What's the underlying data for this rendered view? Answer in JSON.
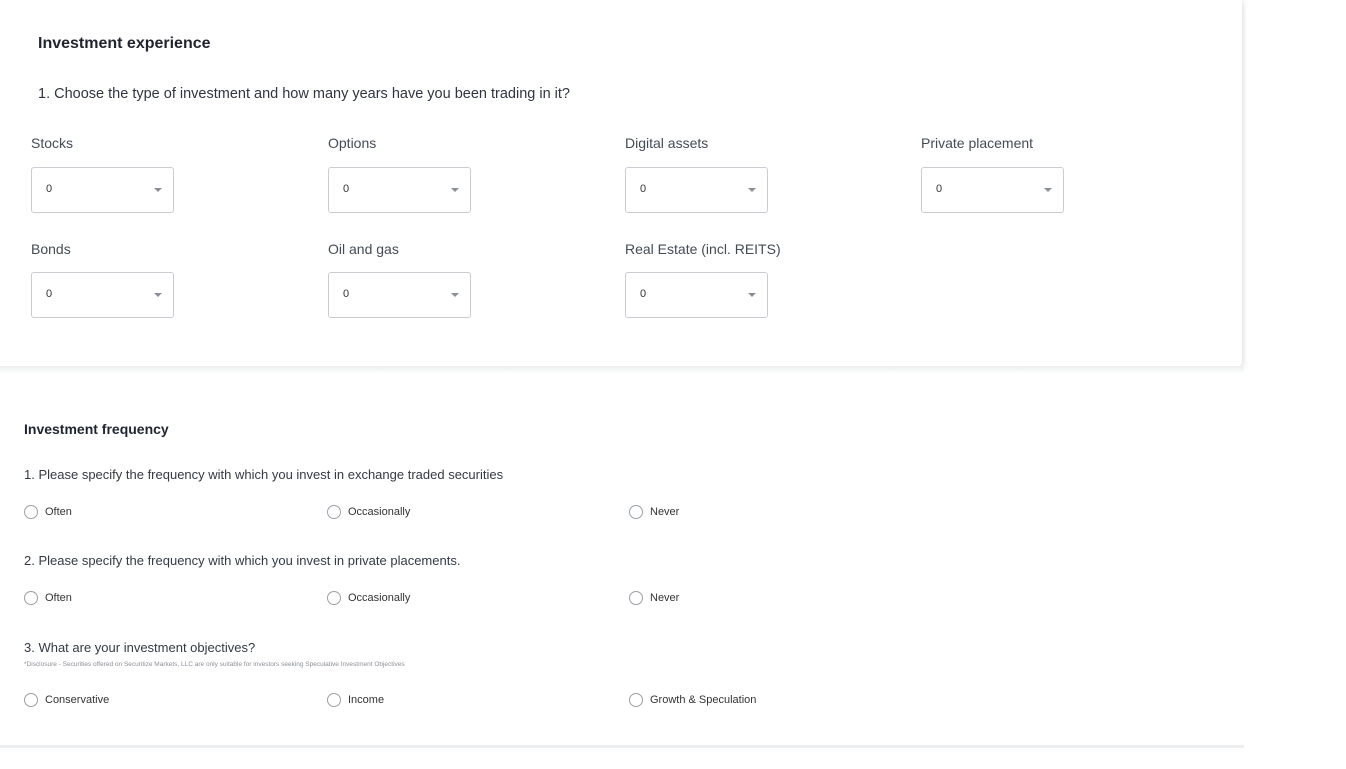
{
  "experience": {
    "title": "Investment experience",
    "question": "1.  Choose the type of investment and how many years have you been trading in it?",
    "fields": [
      {
        "label": "Stocks",
        "value": "0"
      },
      {
        "label": "Options",
        "value": "0"
      },
      {
        "label": "Digital assets",
        "value": "0"
      },
      {
        "label": "Private placement",
        "value": "0"
      },
      {
        "label": "Bonds",
        "value": "0"
      },
      {
        "label": "Oil and gas",
        "value": "0"
      },
      {
        "label": "Real Estate (incl. REITS)",
        "value": "0"
      }
    ]
  },
  "frequency": {
    "title": "Investment frequency",
    "questions": [
      {
        "text": "1.  Please specify the frequency with which you invest in exchange traded securities",
        "options": [
          "Often",
          "Occasionally",
          "Never"
        ]
      },
      {
        "text": "2.  Please specify the frequency with which you invest in private placements.",
        "options": [
          "Often",
          "Occasionally",
          "Never"
        ]
      },
      {
        "text": "3.  What are your investment objectives?",
        "disclosure": "*Disclosure - Securities offered on Securitize Markets, LLC are only suitable for investors seeking Speculative Investment Objectives",
        "options": [
          "Conservative",
          "Income",
          "Growth & Speculation"
        ]
      }
    ]
  }
}
